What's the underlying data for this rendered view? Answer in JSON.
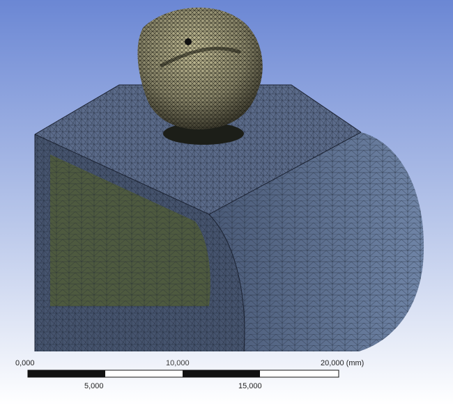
{
  "viewport": {
    "background_top": "#6b87d4",
    "background_bottom": "#ffffff",
    "mesh_block_color": "#4d5f7d",
    "mesh_face_color": "#4e5a3f",
    "mesh_body_color": "#8a866a"
  },
  "scale_bar": {
    "label_0": "0,000",
    "label_5": "5,000",
    "label_10": "10,000",
    "label_15": "15,000",
    "label_20": "20,000",
    "unit": "(mm)"
  }
}
